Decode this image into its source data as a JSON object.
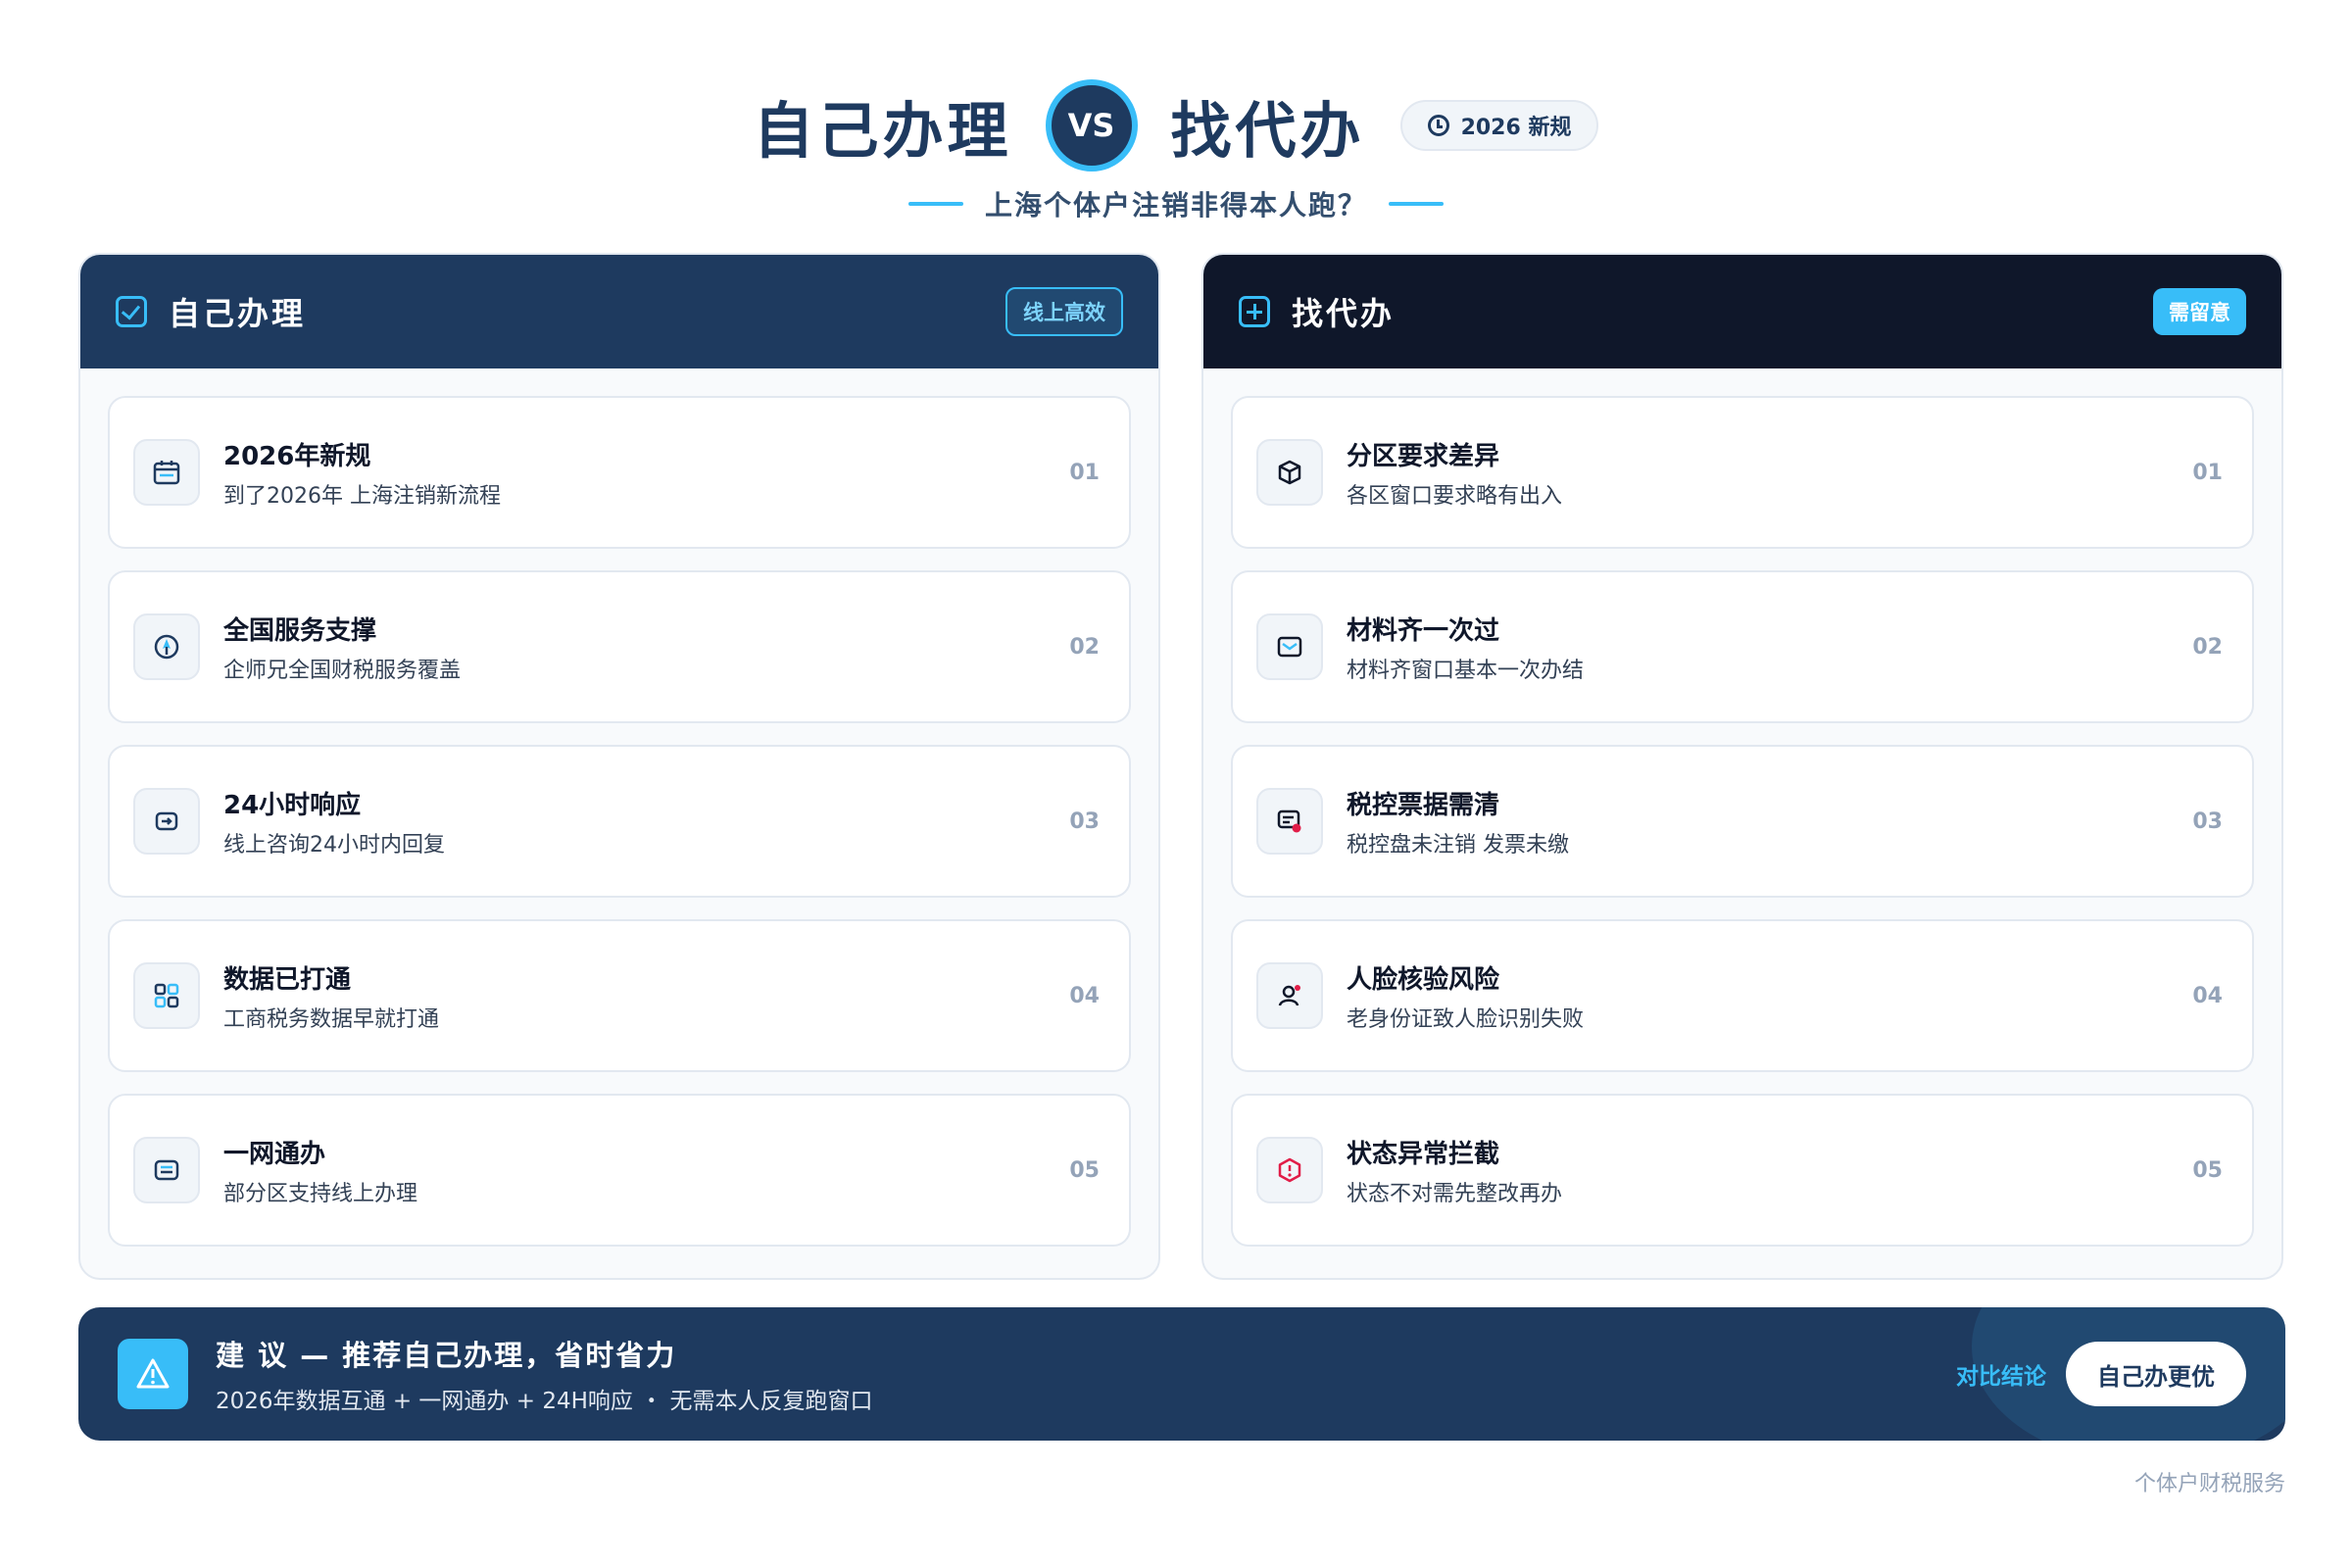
{
  "header": {
    "left_title": "自己办理",
    "vs": "VS",
    "right_title": "找代办",
    "year_pill": "2026 新规",
    "subtitle": "上海个体户注销非得本人跑？"
  },
  "left_panel": {
    "title": "自己办理",
    "tag": "线上高效",
    "items": [
      {
        "title": "2026年新规",
        "desc": "到了2026年 上海注销新流程",
        "num": "01",
        "icon": "calendar-icon"
      },
      {
        "title": "全国服务支撑",
        "desc": "企师兄全国财税服务覆盖",
        "num": "02",
        "icon": "compass-icon"
      },
      {
        "title": "24小时响应",
        "desc": "线上咨询24小时内回复",
        "num": "03",
        "icon": "forward-icon"
      },
      {
        "title": "数据已打通",
        "desc": "工商税务数据早就打通",
        "num": "04",
        "icon": "grid-icon"
      },
      {
        "title": "一网通办",
        "desc": "部分区支持线上办理",
        "num": "05",
        "icon": "document-icon"
      }
    ]
  },
  "right_panel": {
    "title": "找代办",
    "tag": "需留意",
    "items": [
      {
        "title": "分区要求差异",
        "desc": "各区窗口要求略有出入",
        "num": "01",
        "icon": "box-icon"
      },
      {
        "title": "材料齐一次过",
        "desc": "材料齐窗口基本一次办结",
        "num": "02",
        "icon": "mail-icon"
      },
      {
        "title": "税控票据需清",
        "desc": "税控盘未注销 发票未缴",
        "num": "03",
        "icon": "invoice-icon"
      },
      {
        "title": "人脸核验风险",
        "desc": "老身份证致人脸识别失败",
        "num": "04",
        "icon": "user-icon"
      },
      {
        "title": "状态异常拦截",
        "desc": "状态不对需先整改再办",
        "num": "05",
        "icon": "alert-icon"
      }
    ]
  },
  "advice": {
    "title": "建 议 — 推荐自己办理，省时省力",
    "desc": "2026年数据互通 + 一网通办 + 24H响应 ・ 无需本人反复跑窗口",
    "label": "对比结论",
    "button": "自己办更优"
  },
  "footer": "个体户财税服务",
  "colors": {
    "navy": "#1e3a5f",
    "dark": "#0f172a",
    "accent": "#38bdf8",
    "alert": "#e11d48"
  }
}
